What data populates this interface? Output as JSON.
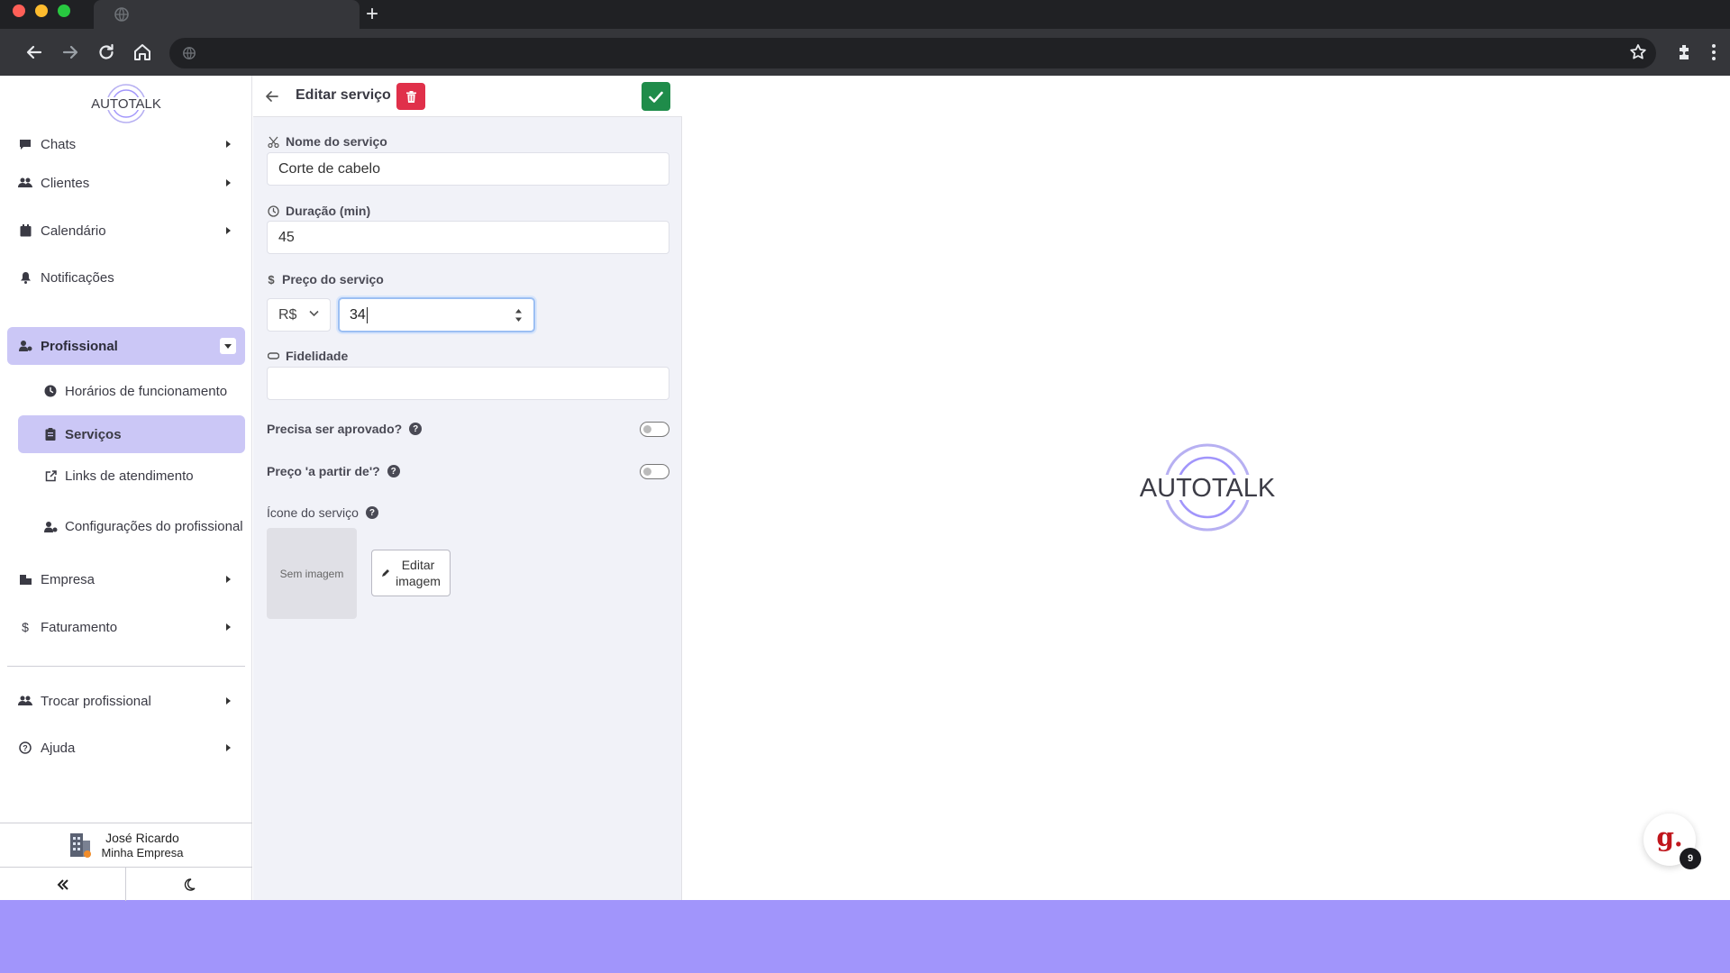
{
  "brand": {
    "name": "AUTOTALK",
    "accent": "#a195fb",
    "active": "#cbc7f6"
  },
  "browser": {
    "new_tab": "+"
  },
  "sidebar": {
    "items": [
      {
        "label": "Chats",
        "icon": "chat-icon"
      },
      {
        "label": "Clientes",
        "icon": "users-icon"
      },
      {
        "label": "Calendário",
        "icon": "calendar-icon"
      },
      {
        "label": "Notificações",
        "icon": "bell-icon"
      },
      {
        "label": "Profissional",
        "icon": "user-gear-icon"
      },
      {
        "label": "Empresa",
        "icon": "building-icon"
      },
      {
        "label": "Faturamento",
        "icon": "dollar-icon"
      },
      {
        "label": "Trocar profissional",
        "icon": "users-swap-icon"
      },
      {
        "label": "Ajuda",
        "icon": "help-circle-icon"
      }
    ],
    "sub_items": [
      {
        "label": "Horários de funcionamento",
        "icon": "clock-icon"
      },
      {
        "label": "Serviços",
        "icon": "clipboard-icon"
      },
      {
        "label": "Links de atendimento",
        "icon": "external-link-icon"
      },
      {
        "label": "Configurações do profissional",
        "icon": "user-gear-icon"
      }
    ],
    "user": {
      "name": "José Ricardo",
      "company": "Minha Empresa"
    }
  },
  "form": {
    "title": "Editar serviço",
    "name_label": "Nome do serviço",
    "name_value": "Corte de cabelo",
    "duration_label": "Duração (min)",
    "duration_value": "45",
    "price_label": "Preço do serviço",
    "currency": "R$",
    "price_value": "34",
    "loyalty_label": "Fidelidade",
    "loyalty_value": "",
    "approval_label": "Precisa ser aprovado?",
    "approval_on": false,
    "from_price_label": "Preço 'a partir de'?",
    "from_price_on": false,
    "icon_label": "Ícone do serviço",
    "no_image": "Sem imagem",
    "edit_image_line1": "Editar",
    "edit_image_line2": "imagem"
  },
  "chat_widget": {
    "letter": "g.",
    "badge": "9"
  }
}
